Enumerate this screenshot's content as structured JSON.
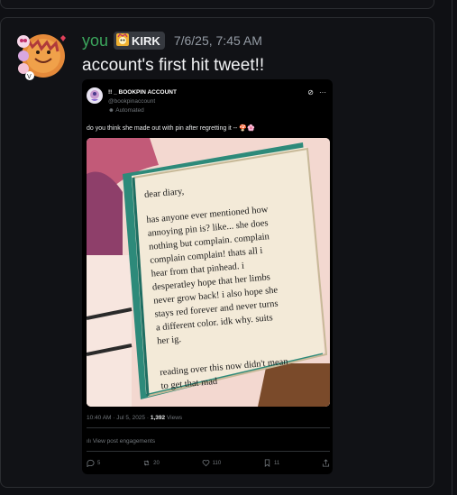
{
  "message": {
    "author": "you",
    "role_badge": "KIRK",
    "timestamp": "7/6/25, 7:45 AM",
    "text": "account's first hit tweet!!"
  },
  "tweet": {
    "display_name": "!! _ BOOKPIN ACCOUNT",
    "handle": "@bookpinaccount",
    "automated_label": "Automated",
    "text": "do you think she made out with pin after regretting it -- 🍄🌸",
    "image_text": {
      "greeting": "dear diary,",
      "body_lines": [
        "has anyone ever mentioned how",
        "annoying pin is? like... she does",
        "nothing but complain. complain",
        "complain complain! thats all i",
        "hear from that pinhead. i",
        "desperatley hope that her limbs",
        "never grow back! i also hope she",
        "stays red forever and never turns",
        "a different color. idk why. suits",
        "her ig."
      ],
      "footer_lines": [
        "reading over this now didn't mean",
        "to get that mad"
      ]
    },
    "meta_time": "10:40 AM · Jul 5, 2025 · ",
    "views_count": "1,392",
    "views_label": " Views",
    "engagements_label": "View post engagements",
    "actions": {
      "replies": "5",
      "reposts": "20",
      "likes": "110",
      "bookmarks": "11"
    }
  },
  "colors": {
    "background": "#0f1014",
    "username": "#3ba55c",
    "timestamp": "#949ba4"
  }
}
